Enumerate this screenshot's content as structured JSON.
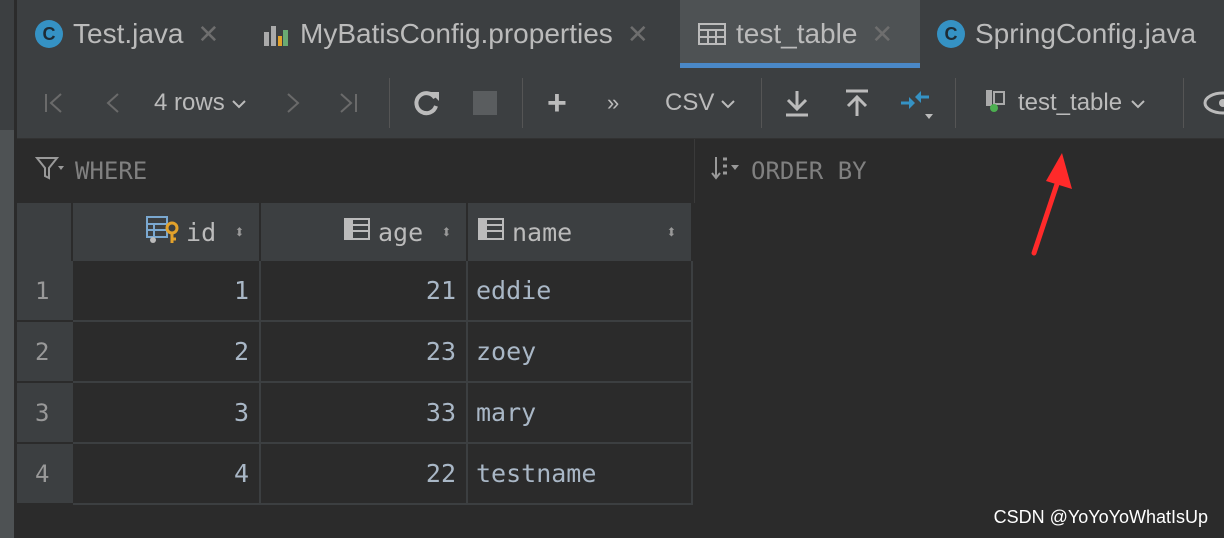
{
  "tabs": [
    {
      "label": "Test.java",
      "icon": "java-class-icon",
      "active": false
    },
    {
      "label": "MyBatisConfig.properties",
      "icon": "properties-file-icon",
      "active": false
    },
    {
      "label": "test_table",
      "icon": "table-icon",
      "active": true
    },
    {
      "label": "SpringConfig.java",
      "icon": "java-class-icon",
      "active": false
    }
  ],
  "toolbar": {
    "rows_label": "4 rows",
    "format_label": "CSV",
    "table_selector": "test_table",
    "more_label": "»"
  },
  "filter": {
    "where_label": "WHERE",
    "orderby_label": "ORDER BY"
  },
  "table": {
    "columns": [
      "id",
      "age",
      "name"
    ],
    "rows": [
      {
        "rownum": "1",
        "id": "1",
        "age": "21",
        "name": "eddie"
      },
      {
        "rownum": "2",
        "id": "2",
        "age": "23",
        "name": "zoey"
      },
      {
        "rownum": "3",
        "id": "3",
        "age": "33",
        "name": "mary"
      },
      {
        "rownum": "4",
        "id": "4",
        "age": "22",
        "name": "testname"
      }
    ]
  },
  "watermark": "CSDN @YoYoYoWhatIsUp",
  "colors": {
    "accent": "#4a88c7",
    "annotation_arrow": "#ff2a2a"
  }
}
